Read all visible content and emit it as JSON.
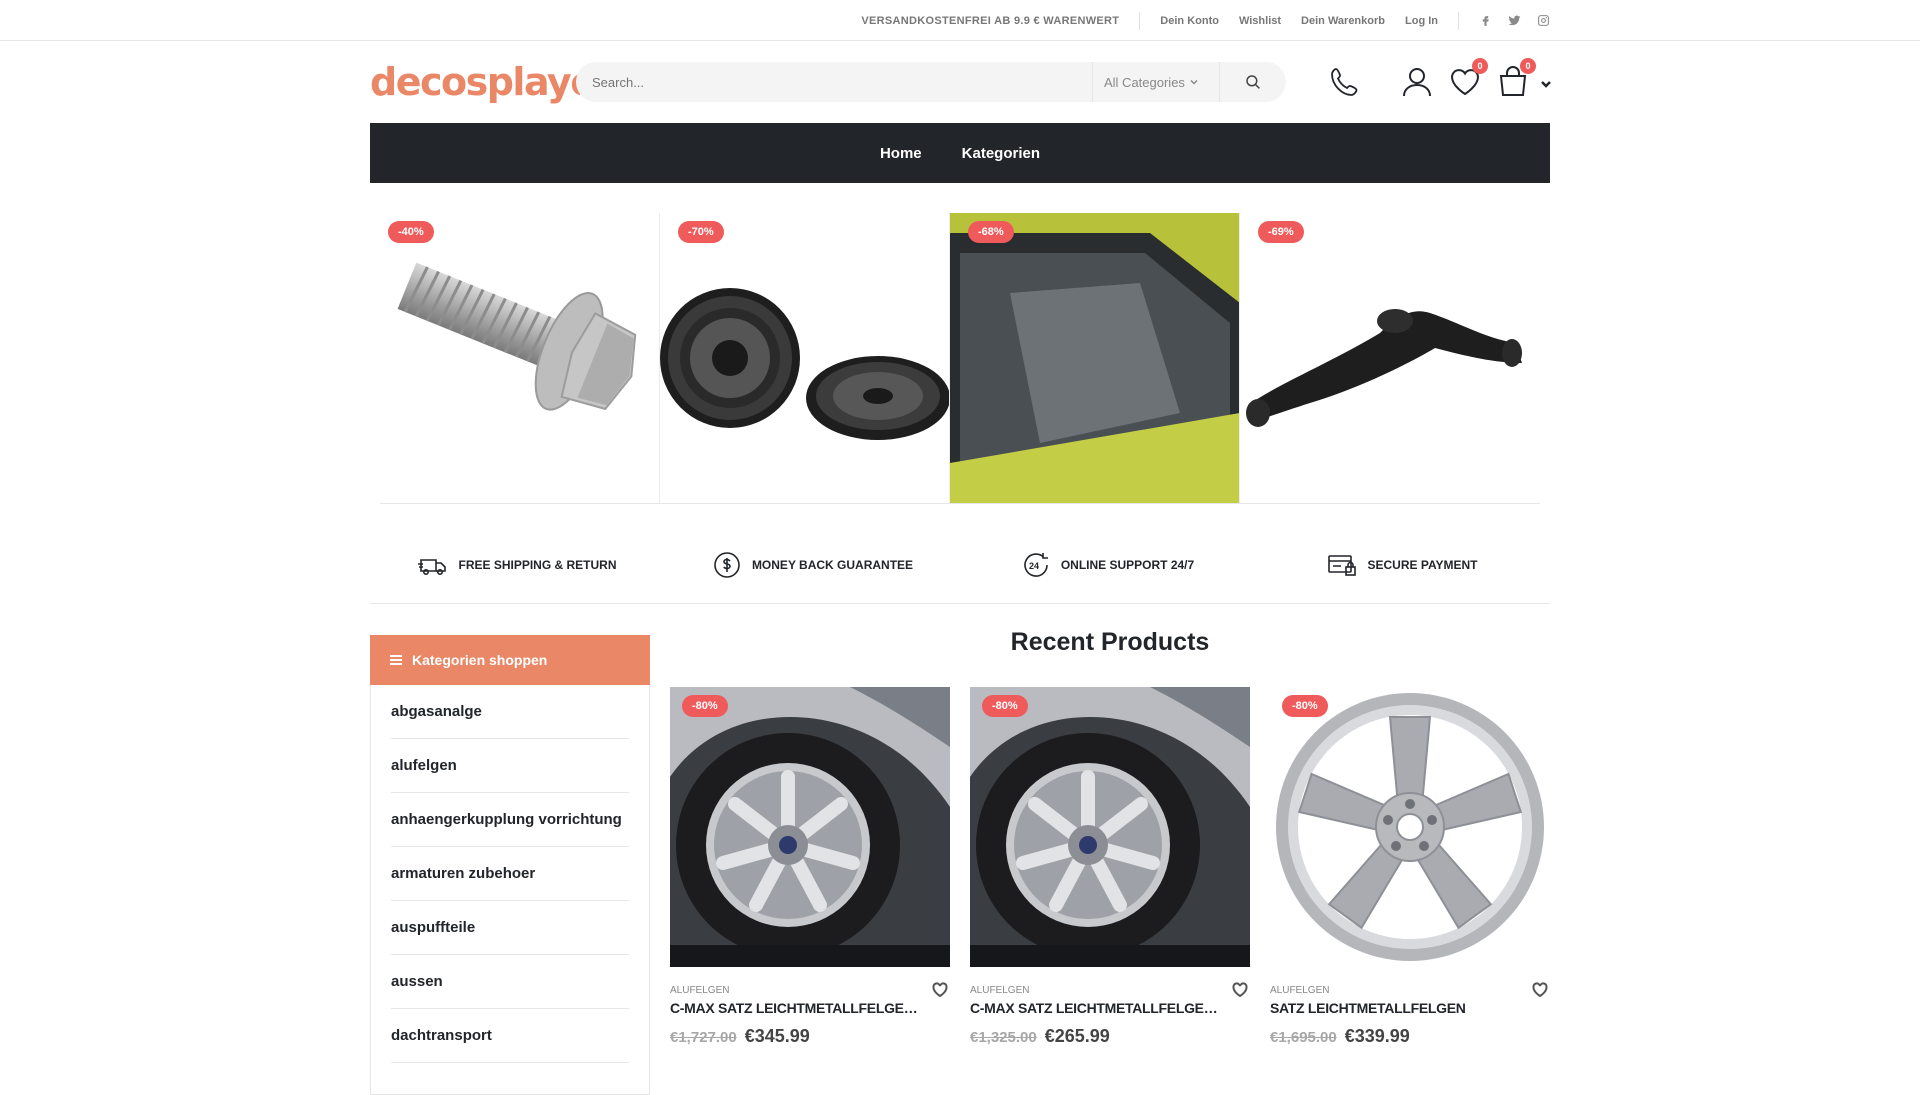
{
  "topbar": {
    "promo": "VERSANDKOSTENFREI AB 9.9 € WARENWERT",
    "links": [
      "Dein Konto",
      "Wishlist",
      "Dein Warenkorb",
      "Log In"
    ],
    "social": [
      "facebook-icon",
      "twitter-icon",
      "instagram-icon"
    ]
  },
  "header": {
    "logo": "decosplaycar",
    "search_placeholder": "Search...",
    "category_select": "All Categories",
    "wishlist_count": "0",
    "cart_count": "0"
  },
  "nav": {
    "items": [
      "Home",
      "Kategorien"
    ]
  },
  "deals": [
    {
      "discount": "-40%",
      "image": "bolt"
    },
    {
      "discount": "-70%",
      "image": "speakers"
    },
    {
      "discount": "-68%",
      "image": "car-window"
    },
    {
      "discount": "-69%",
      "image": "control-arm"
    }
  ],
  "features": [
    {
      "label": "FREE SHIPPING & RETURN",
      "icon": "truck-icon"
    },
    {
      "label": "MONEY BACK GUARANTEE",
      "icon": "dollar-circle-icon"
    },
    {
      "label": "ONLINE SUPPORT 24/7",
      "icon": "support-24-icon"
    },
    {
      "label": "SECURE PAYMENT",
      "icon": "secure-payment-icon"
    }
  ],
  "sidebar": {
    "title": "Kategorien shoppen",
    "items": [
      "abgasanalge",
      "alufelgen",
      "anhaengerkupplung vorrichtung",
      "armaturen zubehoer",
      "auspuffteile",
      "aussen",
      "dachtransport"
    ]
  },
  "recent": {
    "title": "Recent Products",
    "products": [
      {
        "discount": "-80%",
        "category": "ALUFELGEN",
        "name": "C-MAX SATZ LEICHTMETALLFELGEN A...",
        "old_price": "€1,727.00",
        "price": "€345.99"
      },
      {
        "discount": "-80%",
        "category": "ALUFELGEN",
        "name": "C-MAX SATZ LEICHTMETALLFELGEN A...",
        "old_price": "€1,325.00",
        "price": "€265.99"
      },
      {
        "discount": "-80%",
        "category": "ALUFELGEN",
        "name": "SATZ LEICHTMETALLFELGEN",
        "old_price": "€1,695.00",
        "price": "€339.99"
      }
    ]
  },
  "colors": {
    "accent": "#e98766",
    "nav_bg": "#222529",
    "badge": "#ef5b5b"
  }
}
